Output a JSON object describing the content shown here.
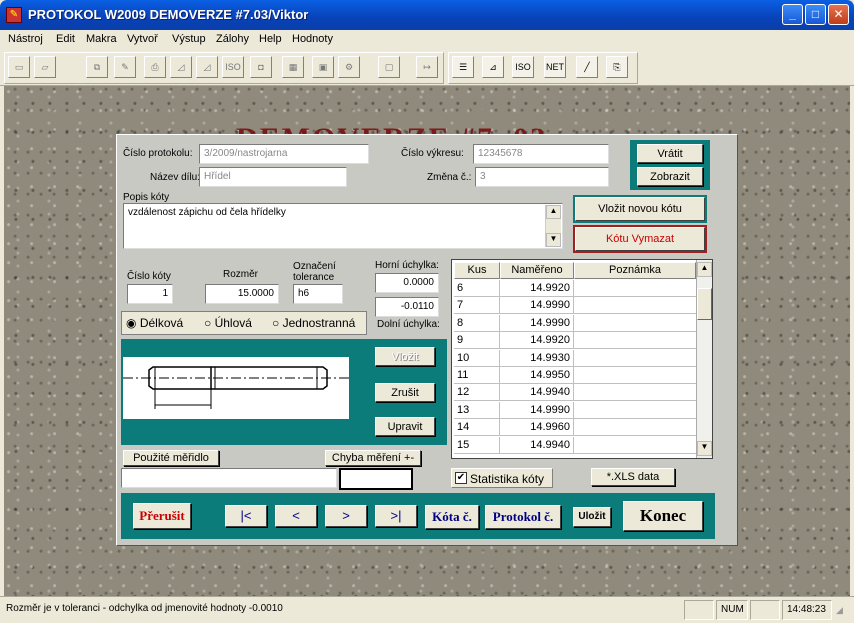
{
  "window": {
    "title": "PROTOKOL W2009  DEMOVERZE  #7.03/Viktor",
    "minimize": "_",
    "maximize": "□",
    "close": "✕"
  },
  "menu": [
    "Nástroj",
    "Edit",
    "Makra",
    "Vytvoř",
    "Výstup",
    "Zálohy",
    "Help",
    "Hodnoty"
  ],
  "toolbar_icons": [
    "new-file-icon",
    "open-folder-icon",
    "copy-icon",
    "brush-icon",
    "print-icon",
    "chart-icon",
    "chart2-icon",
    "iso-icon",
    "export-icon",
    "calc-icon",
    "save-icon",
    "settings-icon",
    "frame-icon",
    "exit-icon",
    "list-icon",
    "ruler-icon",
    "iso-icon",
    "net-icon",
    "graph-icon",
    "clipboard-icon"
  ],
  "toolbar_labels": {
    "iso": "ISO",
    "net": "NET"
  },
  "watermark": "DEMOVERZE   #7 .03",
  "form": {
    "protokol_label": "Číslo protokolu:",
    "protokol_value": "3/2009/nastrojarna",
    "vykres_label": "Číslo výkresu:",
    "vykres_value": "12345678",
    "nazev_label": "Název dílu:",
    "nazev_value": "Hřídel",
    "zmena_label": "Změna č.:",
    "zmena_value": "3",
    "popis_label": "Popis kóty",
    "popis_value": "vzdálenost zápichu od čela hřídelky",
    "cislo_koty_label": "Číslo kóty",
    "cislo_koty_value": "1",
    "rozmer_label": "Rozměr",
    "rozmer_value": "15.0000",
    "tolerance_label_1": "Označení",
    "tolerance_label_2": "tolerance",
    "tolerance_value": "h6",
    "horni_label": "Horní úchylka:",
    "horni_value": "0.0000",
    "dolni_label": "Dolní úchylka:",
    "dolni_value": "-0.0110",
    "radio_delkova": "Délková",
    "radio_uhlova": "Úhlová",
    "radio_jednostranna": "Jednostranná",
    "meridlo_label": "Použité měřidlo",
    "meridlo_value": "",
    "chyba_label": "Chyba měření +-",
    "chyba_value": "",
    "statistika_label": "Statistika kóty",
    "xls_label": "*.XLS data"
  },
  "buttons": {
    "vratit": "Vrátit",
    "zobrazit": "Zobrazit",
    "vlozit_novou": "Vložit novou kótu",
    "kotu_vymazat": "Kótu Vymazat",
    "vlozit": "Vložit",
    "zrusit": "Zrušit",
    "upravit": "Upravit",
    "prerusit": "Přerušit",
    "first": "|<",
    "prev": "<",
    "next": ">",
    "last": ">|",
    "kota_c": "Kóta č.",
    "protokol_c": "Protokol č.",
    "ulozit": "Uložit",
    "konec": "Konec"
  },
  "table": {
    "headers": [
      "Kus",
      "Naměřeno",
      "Poznámka"
    ],
    "rows": [
      {
        "kus": "6",
        "nam": "14.9920",
        "pozn": ""
      },
      {
        "kus": "7",
        "nam": "14.9990",
        "pozn": ""
      },
      {
        "kus": "8",
        "nam": "14.9990",
        "pozn": ""
      },
      {
        "kus": "9",
        "nam": "14.9920",
        "pozn": ""
      },
      {
        "kus": "10",
        "nam": "14.9930",
        "pozn": ""
      },
      {
        "kus": "11",
        "nam": "14.9950",
        "pozn": ""
      },
      {
        "kus": "12",
        "nam": "14.9940",
        "pozn": ""
      },
      {
        "kus": "13",
        "nam": "14.9990",
        "pozn": ""
      },
      {
        "kus": "14",
        "nam": "14.9960",
        "pozn": ""
      },
      {
        "kus": "15",
        "nam": "14.9940",
        "pozn": ""
      }
    ]
  },
  "statusbar": {
    "message": "Rozměr je v toleranci - odchylka od jmenovité hodnoty   -0.0010",
    "num": "NUM",
    "time": "14:48:23"
  },
  "colors": {
    "teal": "#0b7c79",
    "title_blue": "#0842b8",
    "red_text": "#cc0000",
    "navy_text": "#000080"
  }
}
